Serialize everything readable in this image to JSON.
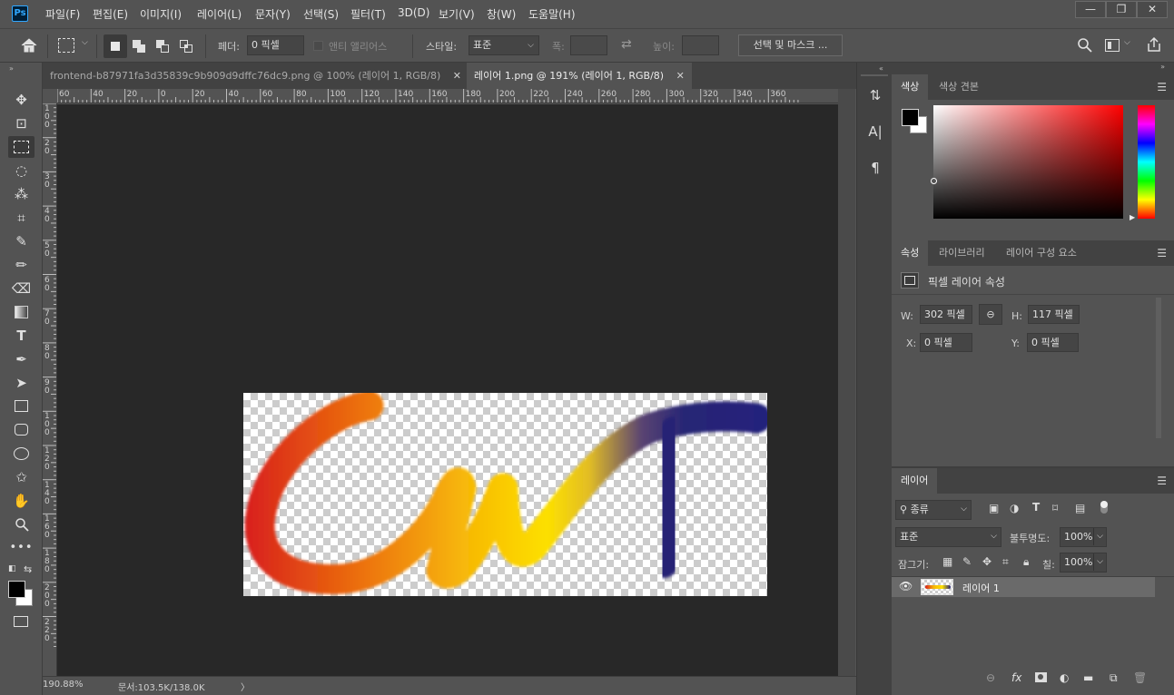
{
  "app": {
    "logo_text": "Ps"
  },
  "menu": {
    "items": [
      "파일(F)",
      "편집(E)",
      "이미지(I)",
      "레이어(L)",
      "문자(Y)",
      "선택(S)",
      "필터(T)",
      "3D(D)",
      "보기(V)",
      "창(W)",
      "도움말(H)"
    ]
  },
  "window_controls": {
    "minimize": "—",
    "restore": "❐",
    "close": "✕"
  },
  "options": {
    "feather_label": "페더:",
    "feather_value": "0 픽셀",
    "antialias_label": "앤티 앨리어스",
    "style_label": "스타일:",
    "style_value": "표준",
    "width_label": "폭:",
    "height_label": "높이:",
    "select_mask_button": "선택 및 마스크 ..."
  },
  "document_tabs": [
    {
      "title": "frontend-b87971fa3d35839c9b909d9dffc76dc9.png @ 100% (레이어 1, RGB/8)",
      "active": false
    },
    {
      "title": "레이어 1.png @ 191% (레이어 1, RGB/8)",
      "active": true
    }
  ],
  "ruler": {
    "h_labels": [
      "60",
      "40",
      "20",
      "0",
      "20",
      "40",
      "60",
      "80",
      "100",
      "120",
      "140",
      "160",
      "180",
      "200",
      "220",
      "240",
      "260",
      "280",
      "300",
      "320",
      "340",
      "360"
    ],
    "v_labels": [
      "1\n0\n0",
      "2\n0",
      "3\n0",
      "4\n0",
      "5\n0",
      "6\n0",
      "7\n0",
      "8\n0",
      "9\n0",
      "1\n0\n0",
      "1\n2\n0",
      "1\n4\n0",
      "1\n6\n0",
      "1\n8\n0",
      "2\n0\n0",
      "2\n2\n0"
    ]
  },
  "status": {
    "zoom": "190.88%",
    "doc_size": "문서:103.5K/138.0K",
    "arrow": "〉"
  },
  "color_panel": {
    "tabs": [
      "색상",
      "색상 견본"
    ],
    "foreground": "#000000",
    "background": "#ffffff",
    "hue": "#ff0000"
  },
  "properties_panel": {
    "tabs": [
      "속성",
      "라이브러리",
      "레이어 구성 요소"
    ],
    "header": "픽셀 레이어 속성",
    "w_label": "W:",
    "w_value": "302 픽셀",
    "h_label": "H:",
    "h_value": "117 픽셀",
    "x_label": "X:",
    "x_value": "0 픽셀",
    "y_label": "Y:",
    "y_value": "0 픽셀"
  },
  "layers_panel": {
    "tab": "레이어",
    "filter_value": "종류",
    "blend_mode": "표준",
    "opacity_label": "불투명도:",
    "opacity_value": "100%",
    "lock_label": "잠그기:",
    "fill_label": "칠:",
    "fill_value": "100%",
    "layers": [
      {
        "name": "레이어 1",
        "visible": true
      }
    ],
    "footer_icons": [
      "link-icon",
      "fx-icon",
      "mask-icon",
      "adjustment-icon",
      "folder-icon",
      "new-layer-icon",
      "trash-icon"
    ]
  },
  "colors": {
    "accent": "#31a8ff",
    "canvas_bg": "#282828",
    "panel_bg": "#535353"
  }
}
